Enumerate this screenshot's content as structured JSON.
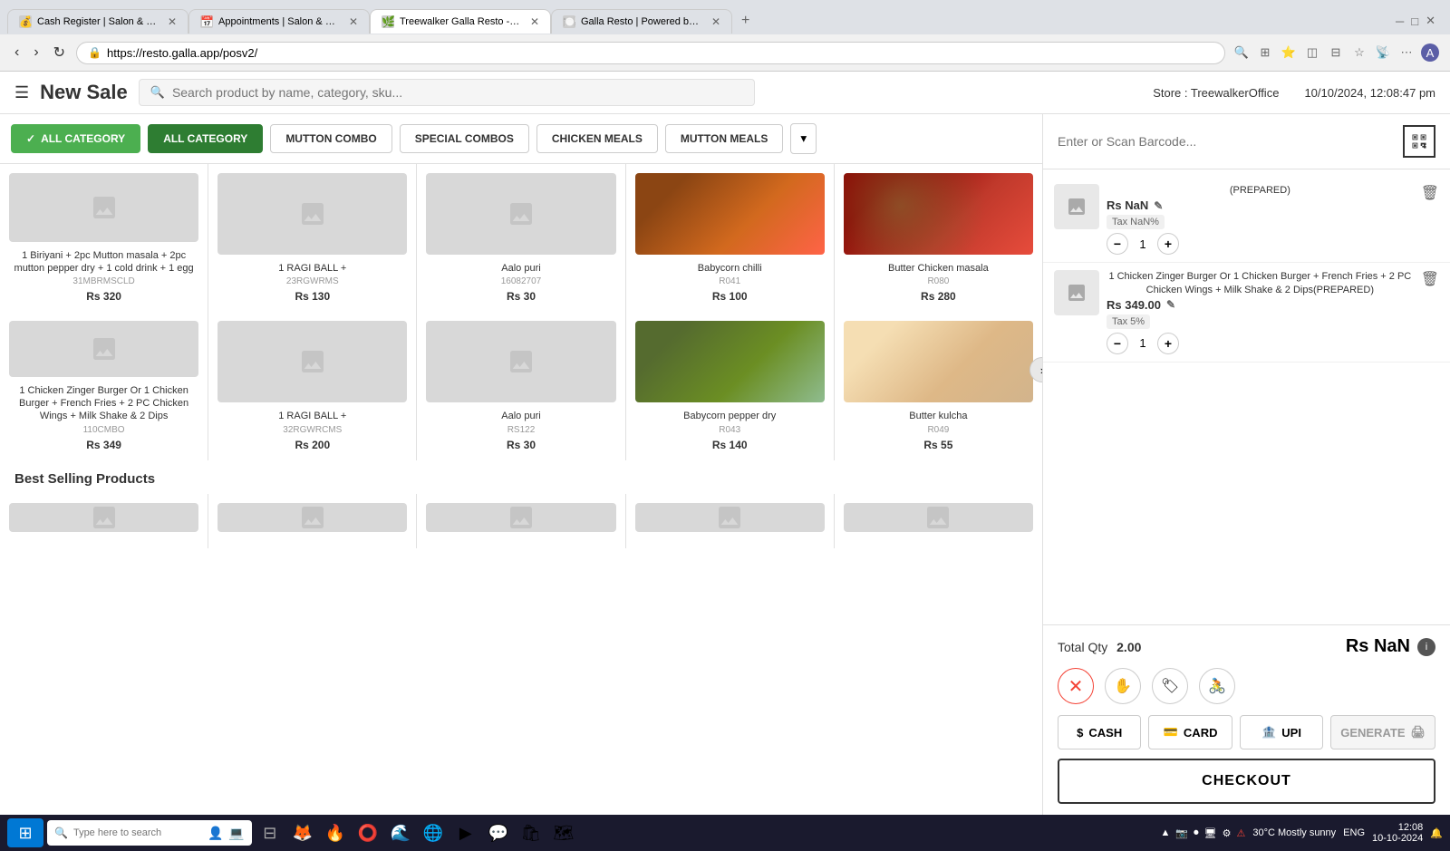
{
  "browser": {
    "url": "https://resto.galla.app/posv2/",
    "tabs": [
      {
        "id": "tab1",
        "title": "Cash Register | Salon & Spa Man...",
        "active": false,
        "favicon": "💰"
      },
      {
        "id": "tab2",
        "title": "Appointments | Salon & Spa Man...",
        "active": false,
        "favicon": "📅"
      },
      {
        "id": "tab3",
        "title": "Treewalker Galla Resto - Galla App",
        "active": true,
        "favicon": "🌿"
      },
      {
        "id": "tab4",
        "title": "Galla Resto | Powered by Galla",
        "active": false,
        "favicon": "🍽️"
      }
    ]
  },
  "header": {
    "menu_icon": "☰",
    "title": "New Sale",
    "search_placeholder": "Search product by name, category, sku...",
    "store": "Store : TreewalkerOffice",
    "datetime": "10/10/2024, 12:08:47 pm"
  },
  "categories": [
    {
      "id": "all1",
      "label": "ALL CATEGORY",
      "type": "active-check"
    },
    {
      "id": "all2",
      "label": "ALL CATEGORY",
      "type": "active-dark"
    },
    {
      "id": "mutton",
      "label": "MUTTON COMBO",
      "type": "normal"
    },
    {
      "id": "special",
      "label": "SPECIAL COMBOS",
      "type": "normal"
    },
    {
      "id": "chicken",
      "label": "CHICKEN MEALS",
      "type": "normal"
    },
    {
      "id": "muttonm",
      "label": "MUTTON MEALS",
      "type": "normal"
    }
  ],
  "products_row1": [
    {
      "name": "1 Biriyani + 2pc Mutton masala + 2pc mutton pepper dry + 1 cold drink + 1 egg",
      "sku": "31MBRMSCLD",
      "price": "Rs 320",
      "has_image": false
    },
    {
      "name": "1 RAGI BALL +",
      "sku": "23RGWRMS",
      "price": "Rs 130",
      "has_image": false
    },
    {
      "name": "Aalo puri",
      "sku": "16082707",
      "price": "Rs 30",
      "has_image": false
    },
    {
      "name": "Babycorn chilli",
      "sku": "R041",
      "price": "Rs 100",
      "has_image": true,
      "img_class": "food-img-1"
    },
    {
      "name": "Butter Chicken masala",
      "sku": "R080",
      "price": "Rs 280",
      "has_image": true,
      "img_class": "food-img-2"
    }
  ],
  "products_row2": [
    {
      "name": "1 Chicken Zinger Burger Or 1 Chicken Burger + French Fries + 2 PC Chicken Wings + Milk Shake & 2 Dips",
      "sku": "110CMBO",
      "price": "Rs 349",
      "has_image": false
    },
    {
      "name": "1 RAGI BALL +",
      "sku": "32RGWRCMS",
      "price": "Rs 200",
      "has_image": false
    },
    {
      "name": "Aalo puri",
      "sku": "RS122",
      "price": "Rs 30",
      "has_image": false
    },
    {
      "name": "Babycorn pepper dry",
      "sku": "R043",
      "price": "Rs 140",
      "has_image": true,
      "img_class": "food-img-veg"
    },
    {
      "name": "Butter kulcha",
      "sku": "R049",
      "price": "Rs 55",
      "has_image": true,
      "img_class": "food-img-kulcha"
    }
  ],
  "best_selling": {
    "heading": "Best Selling Products"
  },
  "sidebar": {
    "barcode_placeholder": "Enter or Scan Barcode...",
    "cart_items": [
      {
        "id": "item1",
        "name": "(PREPARED)",
        "price": "Rs NaN",
        "tax": "Tax NaN%",
        "qty": 1,
        "has_edit": true
      },
      {
        "id": "item2",
        "name": "1 Chicken Zinger Burger Or 1 Chicken Burger + French Fries + 2 PC Chicken Wings + Milk Shake & 2 Dips(PREPARED)",
        "price": "Rs 349.00",
        "tax": "Tax 5%",
        "qty": 1,
        "has_edit": true
      }
    ],
    "total_qty_label": "Total Qty",
    "total_qty_value": "2.00",
    "total_amount": "Rs NaN",
    "payment_buttons": [
      {
        "id": "cash",
        "label": "CASH",
        "icon": "$"
      },
      {
        "id": "card",
        "label": "CARD",
        "icon": "💳"
      },
      {
        "id": "upi",
        "label": "UPI",
        "icon": "🏦"
      }
    ],
    "generate_label": "GENERATE",
    "checkout_label": "CHECKOUT"
  },
  "taskbar": {
    "search_placeholder": "Type here to search",
    "time": "12:08",
    "date": "10-10-2024",
    "weather": "30°C  Mostly sunny",
    "language": "ENG"
  }
}
